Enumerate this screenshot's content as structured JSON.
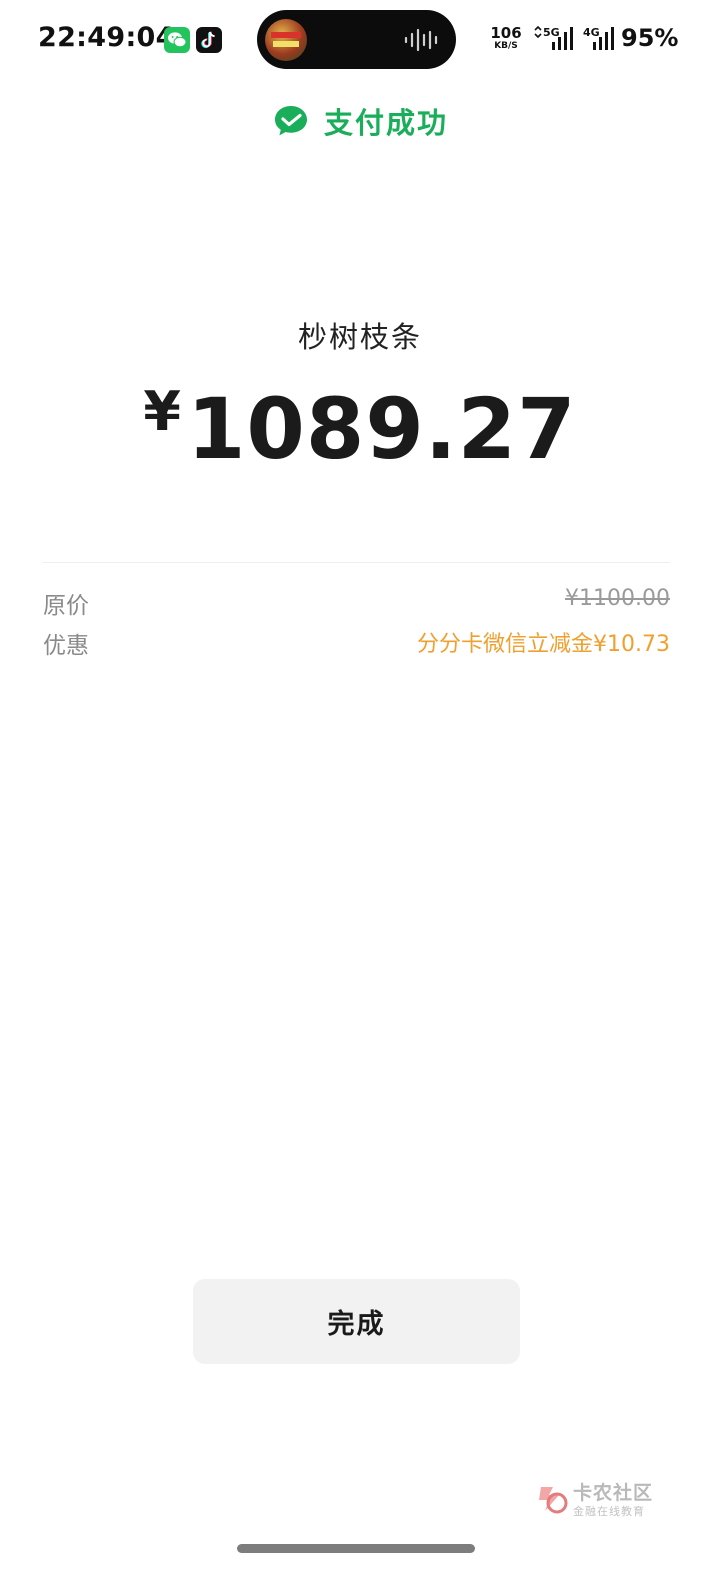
{
  "status_bar": {
    "time": "22:49:04",
    "net_speed_value": "106",
    "net_speed_unit": "KB/S",
    "signal_1_label": "5G",
    "signal_2_label": "4G",
    "battery": "95%",
    "icons": [
      "wechat-icon",
      "douyin-icon",
      "audio-wave-icon",
      "signal-icon"
    ]
  },
  "header": {
    "title": "支付成功",
    "accent_color": "#1aad5a"
  },
  "payment": {
    "merchant": "杪树枝条",
    "currency_symbol": "¥",
    "amount": "1089.27"
  },
  "details": {
    "original_label": "原价",
    "original_value": "¥1100.00",
    "discount_label": "优惠",
    "discount_value": "分分卡微信立减金¥10.73",
    "discount_color": "#f0a02e"
  },
  "actions": {
    "done_label": "完成"
  },
  "watermark": {
    "title": "卡农社区",
    "subtitle": "金融在线教育"
  }
}
